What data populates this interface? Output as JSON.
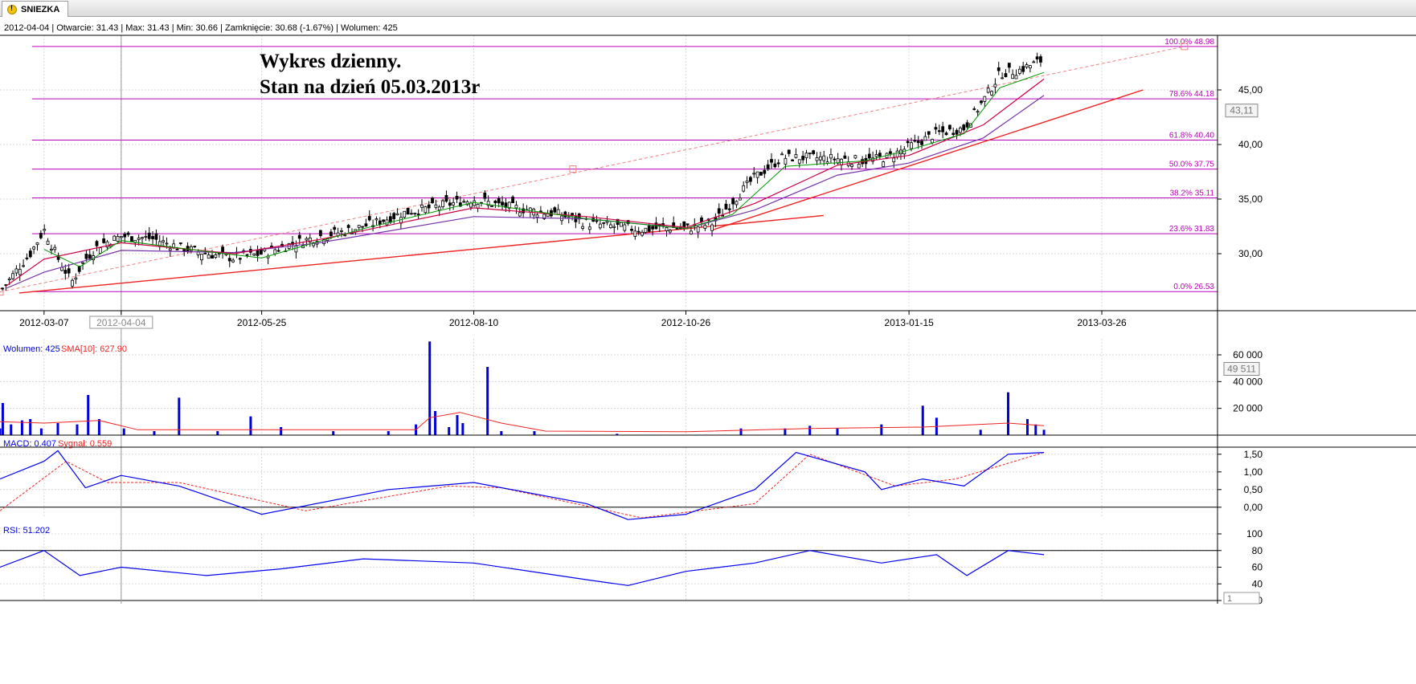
{
  "tab": {
    "label": "SNIEZKA"
  },
  "info_line": "2012-04-04 | Otwarcie: 31.43 | Max: 31.43 | Min: 30.66 | Zamknięcie: 30.68 (-1.67%) | Wolumen: 425",
  "annotation": {
    "line1": "Wykres dzienny.",
    "line2": "Stan na dzień 05.03.2013r"
  },
  "colors": {
    "candle": "#000000",
    "fib": "#bb00bb",
    "sma_short": "#009900",
    "sma_mid": "#cc0044",
    "sma_long": "#7733aa",
    "trend": "#ee2222",
    "volume_bar": "#0000dd",
    "volume_sma": "#ee2222",
    "macd": "#0000ee",
    "signal": "#ee2222",
    "rsi": "#0000ee",
    "grid": "#d8d8d8"
  },
  "chart_data": [
    {
      "type": "candlestick",
      "title": "",
      "x_range": [
        "2012-02-20",
        "2013-05-07"
      ],
      "x_ticks": [
        "2012-03-07",
        "2012-04-04",
        "2012-05-25",
        "2012-08-10",
        "2012-10-26",
        "2013-01-15",
        "2013-03-26"
      ],
      "y_ticks": [
        30,
        35,
        40,
        45
      ],
      "y_tick_labels": [
        "30,00",
        "35,00",
        "40,00",
        "45,00"
      ],
      "ylim": [
        25.0,
        50.0
      ],
      "last_value_label": "43,11",
      "last_value": 43.11,
      "fibonacci": [
        {
          "label": "100.0% 48.98",
          "value": 48.98
        },
        {
          "label": "78.6% 44.18",
          "value": 44.18
        },
        {
          "label": "61.8% 40.40",
          "value": 40.4
        },
        {
          "label": "50.0% 37.75",
          "value": 37.75
        },
        {
          "label": "38.2% 35.11",
          "value": 35.11
        },
        {
          "label": "23.6% 31.83",
          "value": 31.83
        },
        {
          "label": "0.0% 26.53",
          "value": 26.53
        }
      ],
      "close_points": [
        [
          "2012-02-20",
          26.5
        ],
        [
          "2012-02-27",
          28.8
        ],
        [
          "2012-03-02",
          30.0
        ],
        [
          "2012-03-07",
          32.2
        ],
        [
          "2012-03-12",
          29.6
        ],
        [
          "2012-03-17",
          27.4
        ],
        [
          "2012-03-22",
          29.5
        ],
        [
          "2012-03-27",
          30.8
        ],
        [
          "2012-04-04",
          31.6
        ],
        [
          "2012-04-15",
          31.4
        ],
        [
          "2012-04-25",
          30.6
        ],
        [
          "2012-05-05",
          30.0
        ],
        [
          "2012-05-15",
          29.6
        ],
        [
          "2012-05-25",
          30.0
        ],
        [
          "2012-06-05",
          30.9
        ],
        [
          "2012-06-15",
          31.6
        ],
        [
          "2012-06-25",
          32.1
        ],
        [
          "2012-07-05",
          32.8
        ],
        [
          "2012-07-15",
          33.7
        ],
        [
          "2012-07-25",
          34.2
        ],
        [
          "2012-08-04",
          34.7
        ],
        [
          "2012-08-10",
          35.0
        ],
        [
          "2012-08-20",
          34.4
        ],
        [
          "2012-08-30",
          34.0
        ],
        [
          "2012-09-10",
          33.6
        ],
        [
          "2012-09-20",
          32.8
        ],
        [
          "2012-09-30",
          32.5
        ],
        [
          "2012-10-10",
          32.2
        ],
        [
          "2012-10-20",
          32.4
        ],
        [
          "2012-10-26",
          32.3
        ],
        [
          "2012-11-05",
          32.8
        ],
        [
          "2012-11-12",
          34.8
        ],
        [
          "2012-11-20",
          37.0
        ],
        [
          "2012-11-30",
          38.8
        ],
        [
          "2012-12-10",
          38.8
        ],
        [
          "2012-12-20",
          38.7
        ],
        [
          "2012-12-30",
          38.5
        ],
        [
          "2013-01-08",
          38.9
        ],
        [
          "2013-01-15",
          39.8
        ],
        [
          "2013-01-25",
          41.0
        ],
        [
          "2013-02-04",
          41.5
        ],
        [
          "2013-02-11",
          44.0
        ],
        [
          "2013-02-17",
          46.5
        ],
        [
          "2013-02-24",
          46.8
        ],
        [
          "2013-03-05",
          47.8
        ]
      ],
      "sma_short": [
        [
          "2012-03-07",
          30.4
        ],
        [
          "2012-03-20",
          28.8
        ],
        [
          "2012-04-04",
          31.2
        ],
        [
          "2012-05-05",
          30.2
        ],
        [
          "2012-05-25",
          29.6
        ],
        [
          "2012-07-01",
          32.3
        ],
        [
          "2012-08-10",
          34.7
        ],
        [
          "2012-09-20",
          33.2
        ],
        [
          "2012-10-26",
          32.3
        ],
        [
          "2012-11-12",
          33.6
        ],
        [
          "2012-12-01",
          38.0
        ],
        [
          "2012-12-30",
          38.5
        ],
        [
          "2013-01-15",
          39.5
        ],
        [
          "2013-02-04",
          41.0
        ],
        [
          "2013-02-17",
          45.2
        ],
        [
          "2013-03-05",
          46.6
        ]
      ],
      "sma_mid": [
        [
          "2012-02-22",
          27.0
        ],
        [
          "2012-03-07",
          29.5
        ],
        [
          "2012-04-04",
          31.0
        ],
        [
          "2012-05-15",
          30.0
        ],
        [
          "2012-06-15",
          31.3
        ],
        [
          "2012-08-10",
          34.2
        ],
        [
          "2012-09-20",
          33.4
        ],
        [
          "2012-10-26",
          32.4
        ],
        [
          "2012-11-20",
          34.6
        ],
        [
          "2012-12-20",
          38.1
        ],
        [
          "2013-01-15",
          39.0
        ],
        [
          "2013-02-11",
          41.8
        ],
        [
          "2013-03-05",
          46.0
        ]
      ],
      "sma_long": [
        [
          "2012-02-22",
          26.8
        ],
        [
          "2012-03-07",
          28.3
        ],
        [
          "2012-04-04",
          30.3
        ],
        [
          "2012-05-15",
          30.1
        ],
        [
          "2012-06-15",
          31.0
        ],
        [
          "2012-08-10",
          33.4
        ],
        [
          "2012-09-20",
          33.2
        ],
        [
          "2012-10-26",
          32.3
        ],
        [
          "2012-11-20",
          34.0
        ],
        [
          "2012-12-20",
          37.2
        ],
        [
          "2013-01-15",
          38.3
        ],
        [
          "2013-02-11",
          40.6
        ],
        [
          "2013-03-05",
          44.5
        ]
      ],
      "trendlines": [
        {
          "from": [
            "2012-02-27",
            26.4
          ],
          "to": [
            "2012-12-15",
            33.5
          ]
        },
        {
          "from": [
            "2012-11-05",
            32.2
          ],
          "to": [
            "2013-04-10",
            45.0
          ]
        },
        {
          "from": [
            "2012-02-20",
            26.5
          ],
          "to": [
            "2013-04-25",
            48.98
          ],
          "dashed": true
        }
      ]
    },
    {
      "type": "bar",
      "label_left": "Wolumen: 425",
      "label_sma": "SMA[10]: 627.90",
      "ylim": [
        0,
        72000
      ],
      "y_ticks": [
        20000,
        40000,
        60000
      ],
      "y_tick_labels": [
        "20 000",
        "40 000",
        "60 000"
      ],
      "last_value_label": "49 511",
      "last_value": 49511,
      "bars": [
        [
          "2012-02-20",
          5000
        ],
        [
          "2012-02-21",
          24000
        ],
        [
          "2012-02-24",
          8000
        ],
        [
          "2012-02-28",
          11000
        ],
        [
          "2012-03-02",
          12000
        ],
        [
          "2012-03-06",
          5000
        ],
        [
          "2012-03-12",
          9000
        ],
        [
          "2012-03-19",
          8000
        ],
        [
          "2012-03-23",
          30000
        ],
        [
          "2012-03-27",
          12000
        ],
        [
          "2012-04-05",
          5000
        ],
        [
          "2012-04-16",
          3000
        ],
        [
          "2012-04-25",
          28000
        ],
        [
          "2012-05-09",
          3000
        ],
        [
          "2012-05-21",
          14000
        ],
        [
          "2012-06-01",
          6000
        ],
        [
          "2012-06-20",
          3000
        ],
        [
          "2012-07-10",
          3000
        ],
        [
          "2012-07-20",
          8000
        ],
        [
          "2012-07-25",
          70000
        ],
        [
          "2012-07-27",
          18000
        ],
        [
          "2012-08-01",
          6000
        ],
        [
          "2012-08-04",
          15000
        ],
        [
          "2012-08-06",
          9000
        ],
        [
          "2012-08-15",
          51000
        ],
        [
          "2012-08-20",
          3000
        ],
        [
          "2012-09-01",
          3000
        ],
        [
          "2012-10-01",
          1000
        ],
        [
          "2012-11-15",
          5000
        ],
        [
          "2012-12-01",
          5000
        ],
        [
          "2012-12-10",
          7000
        ],
        [
          "2012-12-20",
          5000
        ],
        [
          "2013-01-05",
          8000
        ],
        [
          "2013-01-20",
          22000
        ],
        [
          "2013-01-25",
          13000
        ],
        [
          "2013-02-10",
          4000
        ],
        [
          "2013-02-20",
          32000
        ],
        [
          "2013-02-27",
          12000
        ],
        [
          "2013-03-02",
          8000
        ],
        [
          "2013-03-05",
          4000
        ]
      ],
      "sma": [
        [
          "2012-02-20",
          10000
        ],
        [
          "2012-03-07",
          9000
        ],
        [
          "2012-03-27",
          11000
        ],
        [
          "2012-04-10",
          4000
        ],
        [
          "2012-05-25",
          4000
        ],
        [
          "2012-07-20",
          4000
        ],
        [
          "2012-07-25",
          13000
        ],
        [
          "2012-08-05",
          17000
        ],
        [
          "2012-08-20",
          9000
        ],
        [
          "2012-09-05",
          3000
        ],
        [
          "2012-10-26",
          2500
        ],
        [
          "2012-12-10",
          5000
        ],
        [
          "2013-01-20",
          6000
        ],
        [
          "2013-02-20",
          9000
        ],
        [
          "2013-03-05",
          7000
        ]
      ]
    },
    {
      "type": "line",
      "label_macd": "MACD: 0.407",
      "label_signal": "Sygnał: 0.559",
      "ylim": [
        -0.3,
        1.7
      ],
      "y_ticks": [
        0.0,
        0.5,
        1.0,
        1.5
      ],
      "y_tick_labels": [
        "0,00",
        "0,50",
        "1,00",
        "1,50"
      ],
      "macd": [
        [
          "2012-02-20",
          0.8
        ],
        [
          "2012-03-07",
          1.3
        ],
        [
          "2012-03-12",
          1.6
        ],
        [
          "2012-03-22",
          0.55
        ],
        [
          "2012-04-04",
          0.9
        ],
        [
          "2012-04-25",
          0.6
        ],
        [
          "2012-05-25",
          -0.2
        ],
        [
          "2012-07-10",
          0.5
        ],
        [
          "2012-08-10",
          0.7
        ],
        [
          "2012-09-20",
          0.1
        ],
        [
          "2012-10-05",
          -0.35
        ],
        [
          "2012-10-26",
          -0.2
        ],
        [
          "2012-11-20",
          0.5
        ],
        [
          "2012-12-05",
          1.55
        ],
        [
          "2012-12-30",
          1.0
        ],
        [
          "2013-01-05",
          0.5
        ],
        [
          "2013-01-20",
          0.8
        ],
        [
          "2013-02-04",
          0.6
        ],
        [
          "2013-02-20",
          1.5
        ],
        [
          "2013-03-05",
          1.55
        ]
      ],
      "signal": [
        [
          "2012-02-20",
          -0.1
        ],
        [
          "2012-03-15",
          1.3
        ],
        [
          "2012-03-30",
          0.7
        ],
        [
          "2012-04-25",
          0.7
        ],
        [
          "2012-06-10",
          -0.1
        ],
        [
          "2012-08-01",
          0.6
        ],
        [
          "2012-08-20",
          0.55
        ],
        [
          "2012-10-10",
          -0.3
        ],
        [
          "2012-11-20",
          0.1
        ],
        [
          "2012-12-10",
          1.5
        ],
        [
          "2013-01-10",
          0.6
        ],
        [
          "2013-02-01",
          0.8
        ],
        [
          "2013-03-05",
          1.55
        ]
      ]
    },
    {
      "type": "line",
      "label": "RSI: 51.202",
      "ylim": [
        20,
        100
      ],
      "y_ticks": [
        20,
        40,
        60,
        80,
        100
      ],
      "y_tick_labels": [
        "20",
        "40",
        "60",
        "80",
        "100"
      ],
      "reference_lines": [
        80,
        20
      ],
      "rsi": [
        [
          "2012-02-20",
          60
        ],
        [
          "2012-03-07",
          80
        ],
        [
          "2012-03-20",
          50
        ],
        [
          "2012-04-04",
          60
        ],
        [
          "2012-05-05",
          50
        ],
        [
          "2012-06-01",
          58
        ],
        [
          "2012-07-01",
          70
        ],
        [
          "2012-08-10",
          65
        ],
        [
          "2012-09-20",
          45
        ],
        [
          "2012-10-05",
          38
        ],
        [
          "2012-10-26",
          55
        ],
        [
          "2012-11-20",
          65
        ],
        [
          "2012-12-10",
          80
        ],
        [
          "2013-01-05",
          65
        ],
        [
          "2013-01-25",
          75
        ],
        [
          "2013-02-05",
          50
        ],
        [
          "2013-02-20",
          80
        ],
        [
          "2013-03-05",
          75
        ]
      ],
      "bottom_label": "1"
    }
  ]
}
